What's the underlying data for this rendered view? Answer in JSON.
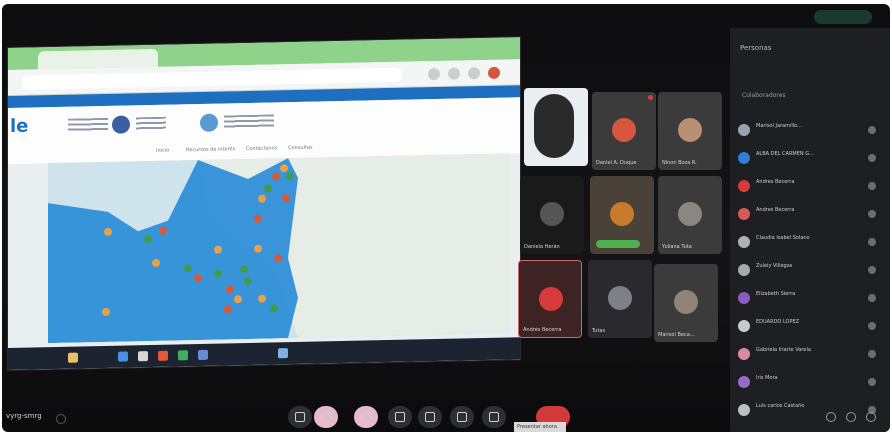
{
  "window": {
    "top_pill": "",
    "meeting_code": "vyrg-smrg"
  },
  "browser": {
    "tab_title": "",
    "url": "",
    "site_logo": "le",
    "nav": {
      "items": [
        "Inicio",
        "Recursos de interés",
        "Contáctanos",
        "Consultas"
      ],
      "active": ""
    },
    "map": {
      "land_color": "#e6ece6",
      "highlight_color": "#2f8fd8",
      "marker_colors": [
        "#e8a04a",
        "#3f9c4e",
        "#d65a3a"
      ]
    }
  },
  "tiles": [
    {
      "name": "",
      "avatar_color": "#9ab8cf"
    },
    {
      "name": "Daniel A. Duque",
      "avatar_color": "#d8553e"
    },
    {
      "name": "Ninon Boza R.",
      "avatar_color": "#b88f70"
    },
    {
      "name": "Daniela Herán",
      "avatar_color": "#555555"
    },
    {
      "name": "",
      "avatar_color": "#c97a2a"
    },
    {
      "name": "Yuliana Tuta",
      "avatar_color": "#8b8680"
    },
    {
      "name": "Andrés Becerra",
      "avatar_color": "#d63a3a"
    },
    {
      "name": "Tutas",
      "avatar_color": "#7f7f8a"
    },
    {
      "name": "Marisol Beca...",
      "avatar_color": "#8e8476"
    }
  ],
  "panel": {
    "title": "Personas",
    "invite": "",
    "section": "Colaboradores",
    "participants": [
      {
        "name": "Marisol Jaramillo...",
        "sub": "",
        "avatar_color": "#9aa4b0"
      },
      {
        "name": "ALBA DEL CARMEN G...",
        "sub": "",
        "avatar_color": "#2e7fd6"
      },
      {
        "name": "Andres Becerra",
        "sub": "",
        "avatar_color": "#d63a3a"
      },
      {
        "name": "Andres Becerra",
        "sub": "",
        "avatar_color": "#d65a5a"
      },
      {
        "name": "Claudia Isabel Solano",
        "sub": "",
        "avatar_color": "#b0b0b0"
      },
      {
        "name": "Zuleiy Villegas",
        "sub": "",
        "avatar_color": "#a8a8a8"
      },
      {
        "name": "Elizabeth Sierra",
        "sub": "",
        "avatar_color": "#8a5ac2"
      },
      {
        "name": "EDUARDO LOPEZ",
        "sub": "",
        "avatar_color": "#c9c9c9"
      },
      {
        "name": "Gabriela Iriarte Varela",
        "sub": "",
        "avatar_color": "#d98aa0"
      },
      {
        "name": "Iris Mora",
        "sub": "",
        "avatar_color": "#9a6ac8"
      },
      {
        "name": "Luis carlos Castaño",
        "sub": "",
        "avatar_color": "#bfbfbf"
      }
    ]
  },
  "bottom": {
    "caption": "Presentar ahora"
  }
}
